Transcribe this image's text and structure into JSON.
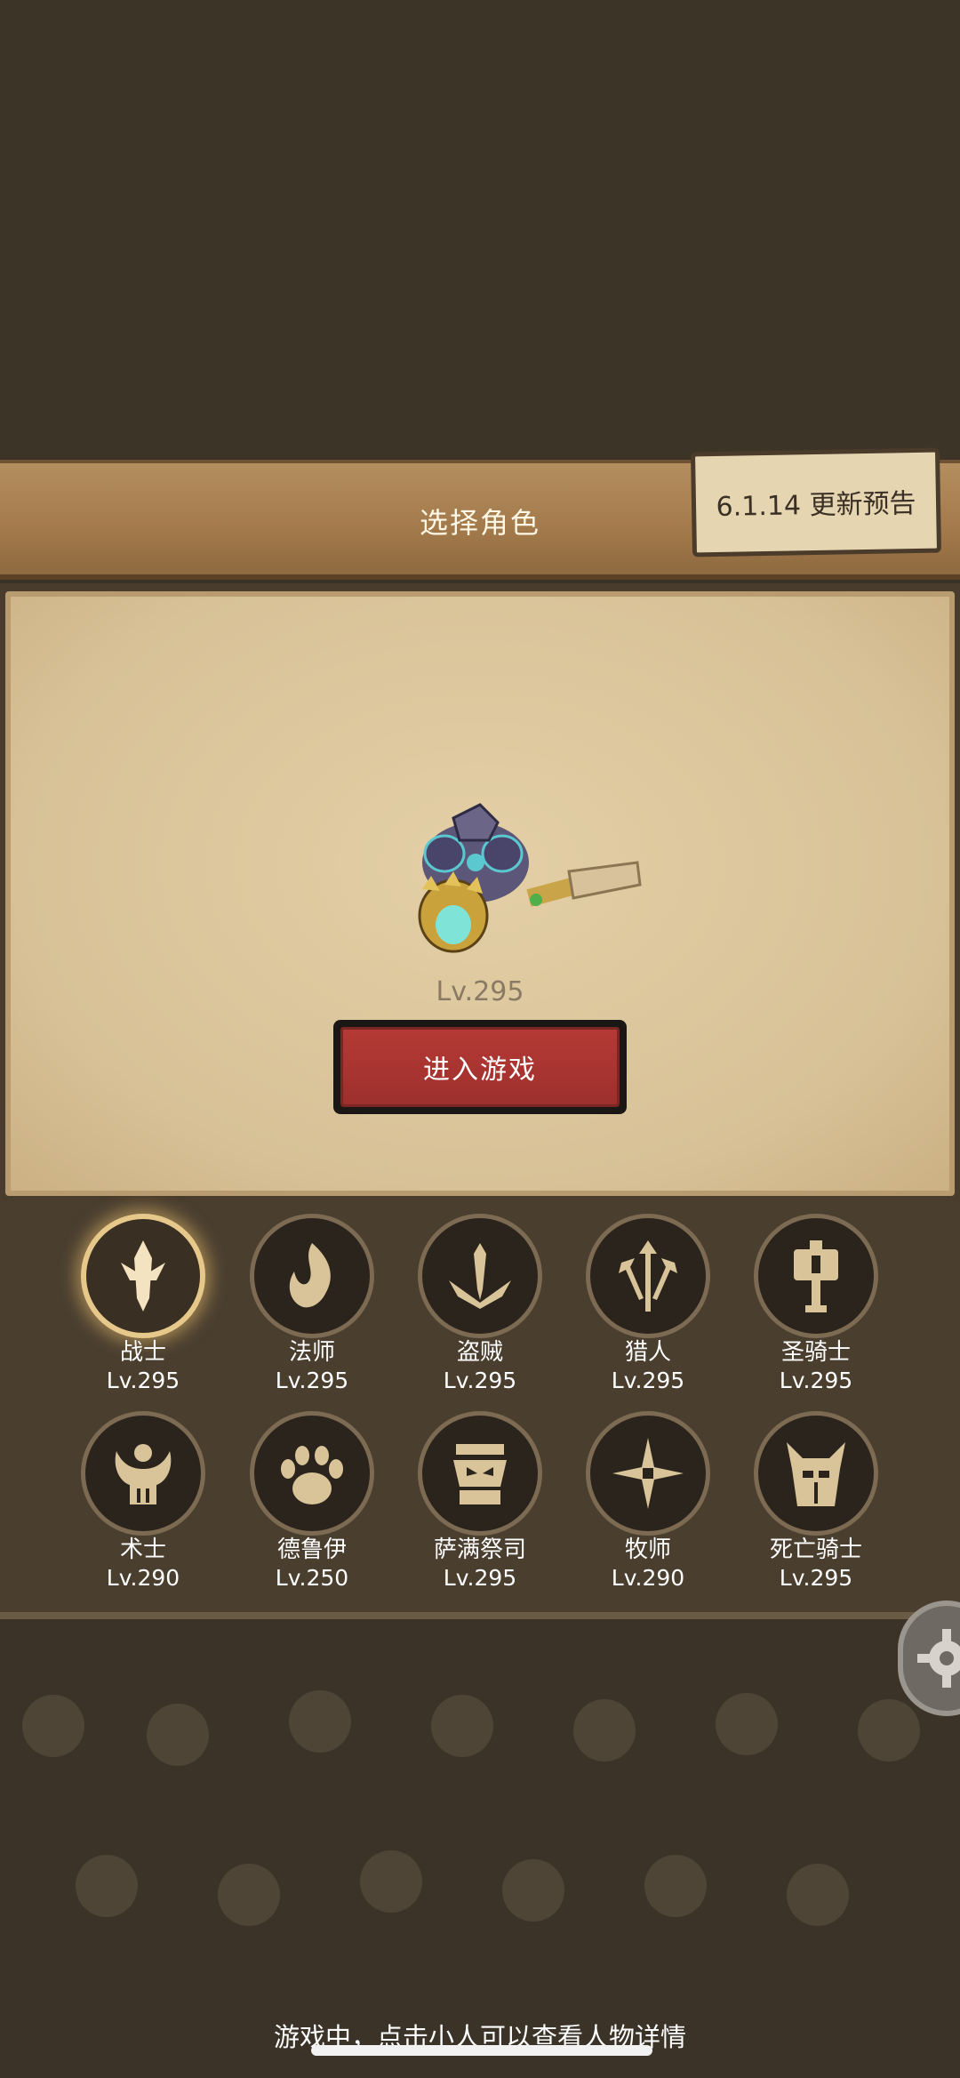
{
  "header": {
    "title": "选择角色",
    "update_notice": "6.1.14 更新预告"
  },
  "selected_character": {
    "level": "Lv.295",
    "enter_button": "进入游戏"
  },
  "classes": [
    {
      "name": "战士",
      "level": "Lv.295",
      "icon": "warrior-sword-icon",
      "selected": true
    },
    {
      "name": "法师",
      "level": "Lv.295",
      "icon": "mage-flame-icon"
    },
    {
      "name": "盗贼",
      "level": "Lv.295",
      "icon": "rogue-daggers-icon"
    },
    {
      "name": "猎人",
      "level": "Lv.295",
      "icon": "hunter-arrows-icon"
    },
    {
      "name": "圣骑士",
      "level": "Lv.295",
      "icon": "paladin-hammer-icon"
    },
    {
      "name": "术士",
      "level": "Lv.290",
      "icon": "warlock-skull-icon"
    },
    {
      "name": "德鲁伊",
      "level": "Lv.250",
      "icon": "druid-paw-icon"
    },
    {
      "name": "萨满祭司",
      "level": "Lv.295",
      "icon": "shaman-totem-icon"
    },
    {
      "name": "牧师",
      "level": "Lv.290",
      "icon": "priest-star-icon"
    },
    {
      "name": "死亡骑士",
      "level": "Lv.295",
      "icon": "deathknight-helm-icon"
    }
  ],
  "footer": {
    "tip": "游戏中，点击小人可以查看人物详情"
  },
  "colors": {
    "accent_gold": "#e6c98a",
    "button_red": "#b63a36",
    "icon_tan": "#d9c49a"
  }
}
